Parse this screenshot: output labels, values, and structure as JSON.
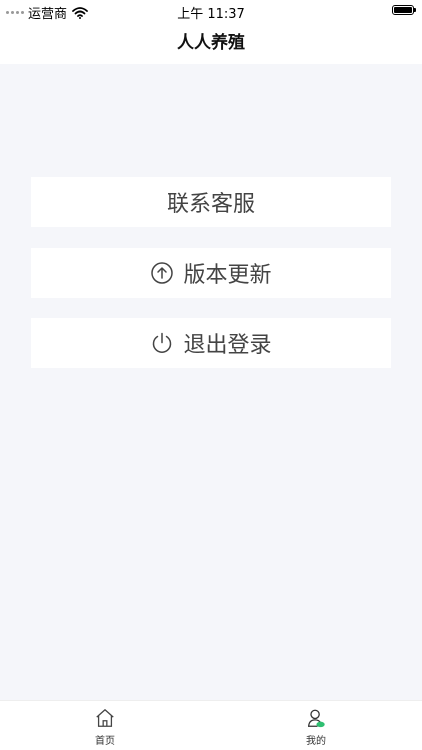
{
  "status_bar": {
    "carrier": "运营商",
    "time": "上午 11:37"
  },
  "navbar": {
    "title": "人人养殖"
  },
  "menu": {
    "contact": {
      "label": "联系客服"
    },
    "update": {
      "label": "版本更新",
      "icon": "arrow-up-circle-icon"
    },
    "logout": {
      "label": "退出登录",
      "icon": "power-icon"
    }
  },
  "tabbar": {
    "home": {
      "label": "首页",
      "icon": "home-icon"
    },
    "mine": {
      "label": "我的",
      "icon": "user-icon",
      "active_color": "#2fbf71"
    }
  },
  "colors": {
    "background": "#f5f6fa",
    "card": "#ffffff",
    "accent": "#2fbf71"
  }
}
